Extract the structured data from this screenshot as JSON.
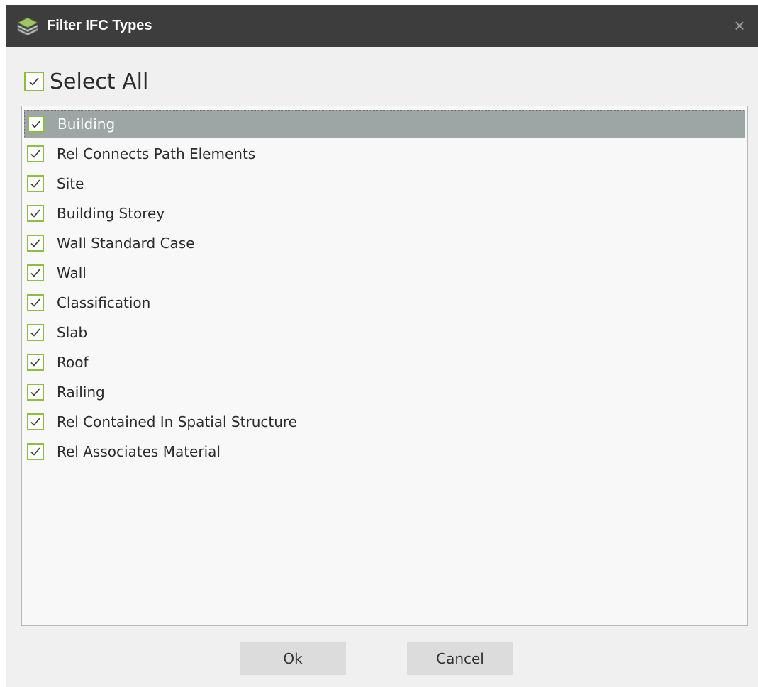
{
  "window": {
    "title": "Filter IFC Types",
    "app_icon": "layers-icon",
    "close_glyph": "×"
  },
  "select_all": {
    "label": "Select All",
    "checked": true
  },
  "items": [
    {
      "label": "Building",
      "checked": true,
      "selected": true
    },
    {
      "label": "Rel Connects Path Elements",
      "checked": true,
      "selected": false
    },
    {
      "label": "Site",
      "checked": true,
      "selected": false
    },
    {
      "label": "Building Storey",
      "checked": true,
      "selected": false
    },
    {
      "label": "Wall Standard Case",
      "checked": true,
      "selected": false
    },
    {
      "label": "Wall",
      "checked": true,
      "selected": false
    },
    {
      "label": "Classification",
      "checked": true,
      "selected": false
    },
    {
      "label": "Slab",
      "checked": true,
      "selected": false
    },
    {
      "label": "Roof",
      "checked": true,
      "selected": false
    },
    {
      "label": "Railing",
      "checked": true,
      "selected": false
    },
    {
      "label": "Rel Contained In Spatial Structure",
      "checked": true,
      "selected": false
    },
    {
      "label": "Rel Associates Material",
      "checked": true,
      "selected": false
    }
  ],
  "buttons": {
    "ok": "Ok",
    "cancel": "Cancel"
  },
  "colors": {
    "titlebar": "#3d3d3d",
    "checkbox_border": "#8cbf3f",
    "selected_row": "#9ea5a5"
  }
}
